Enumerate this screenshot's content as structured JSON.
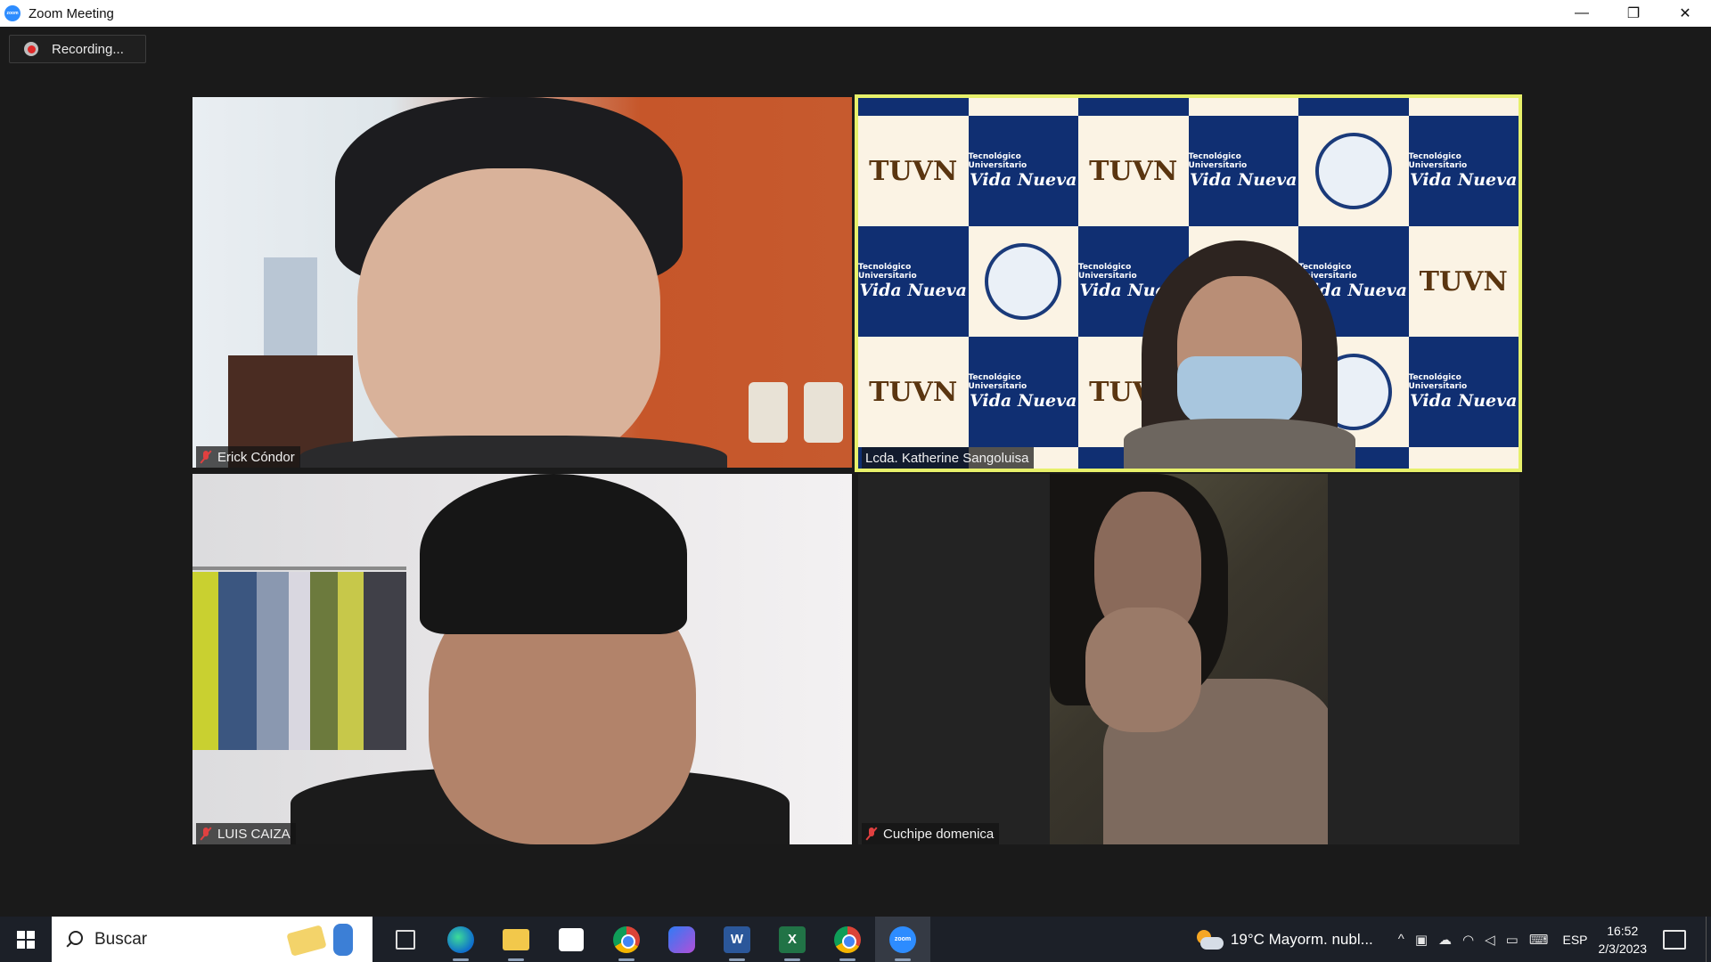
{
  "window": {
    "title": "Zoom Meeting",
    "app_icon_text": "zoom",
    "controls": {
      "minimize": "—",
      "restore": "❐",
      "close": "✕"
    }
  },
  "meeting": {
    "recording_label": "Recording...",
    "participants": [
      {
        "name": "Erick Cóndor",
        "muted": true
      },
      {
        "name": "Lcda. Katherine Sangoluisa",
        "muted": false,
        "active_speaker": true
      },
      {
        "name": "LUIS CAIZA",
        "muted": true
      },
      {
        "name": "Cuchipe domenica",
        "muted": true
      }
    ],
    "background": {
      "small_text": "Tecnológico Universitario",
      "big_text": "Vida Nueva",
      "logo_text": "TUVN"
    },
    "active_speaker_border": "#e7f06a"
  },
  "taskbar": {
    "search_placeholder": "Buscar",
    "apps": [
      {
        "icon": "task-view-icon",
        "label": ""
      },
      {
        "icon": "edge-icon",
        "label": ""
      },
      {
        "icon": "file-explorer-icon",
        "label": ""
      },
      {
        "icon": "microsoft-store-icon",
        "label": ""
      },
      {
        "icon": "chrome-icon",
        "label": ""
      },
      {
        "icon": "bing-icon",
        "label": ""
      },
      {
        "icon": "word-icon",
        "label": "W"
      },
      {
        "icon": "excel-icon",
        "label": "X"
      },
      {
        "icon": "chrome-profile-icon",
        "label": ""
      },
      {
        "icon": "zoom-icon",
        "label": "zoom"
      }
    ],
    "weather": "19°C  Mayorm. nubl...",
    "language": "ESP",
    "time": "16:52",
    "date": "2/3/2023"
  }
}
